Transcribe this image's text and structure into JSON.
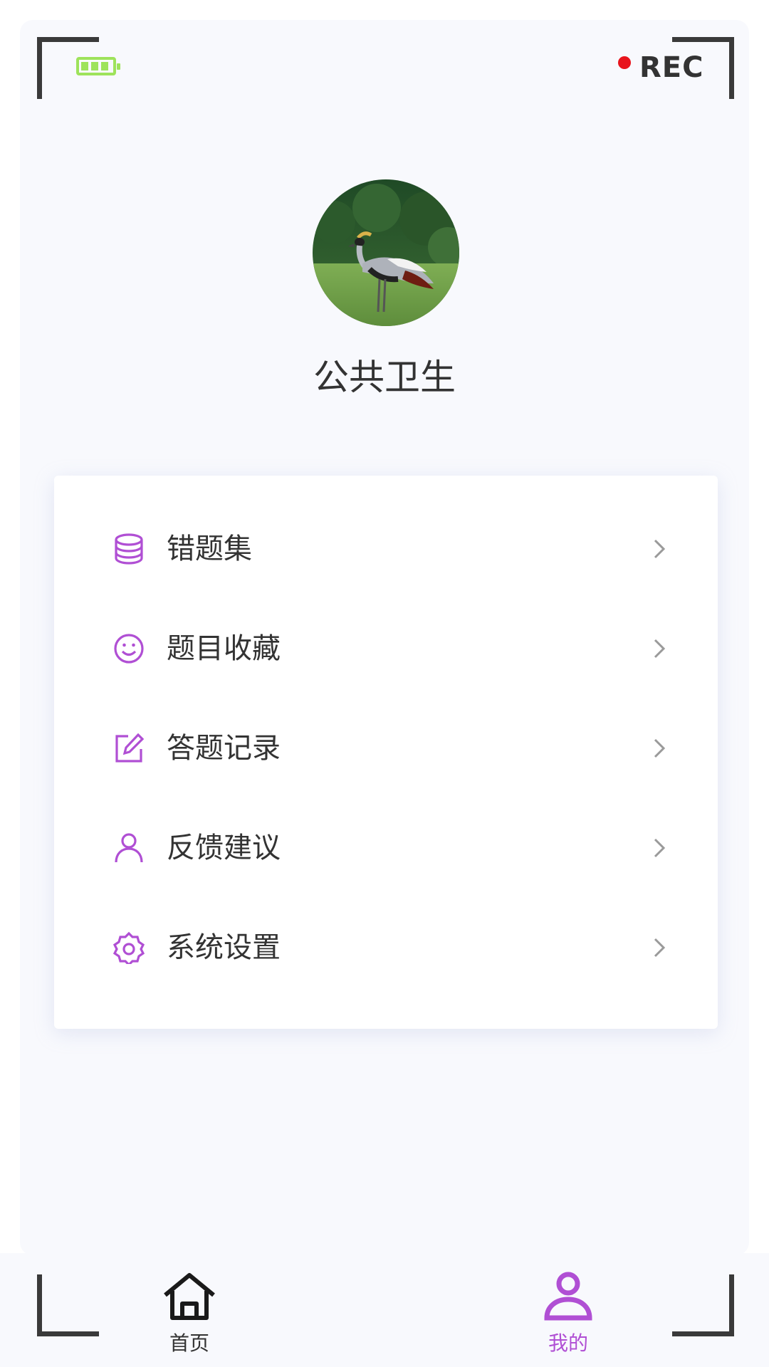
{
  "status": {
    "rec_label": "REC",
    "battery_color": "#9ee35b",
    "rec_dot_color": "#e8141c"
  },
  "profile": {
    "name": "公共卫生",
    "avatar": "crowned-crane-photo"
  },
  "menu": {
    "accent_color": "#b04fd4",
    "items": [
      {
        "label": "错题集",
        "icon": "database-icon"
      },
      {
        "label": "题目收藏",
        "icon": "smiley-icon"
      },
      {
        "label": "答题记录",
        "icon": "edit-icon"
      },
      {
        "label": "反馈建议",
        "icon": "user-icon"
      },
      {
        "label": "系统设置",
        "icon": "settings-icon"
      }
    ]
  },
  "tabbar": {
    "tabs": [
      {
        "label": "首页",
        "icon": "home-icon",
        "active": false
      },
      {
        "label": "我的",
        "icon": "person-icon",
        "active": true
      }
    ],
    "active_color": "#b04fd4",
    "inactive_color": "#333333"
  }
}
